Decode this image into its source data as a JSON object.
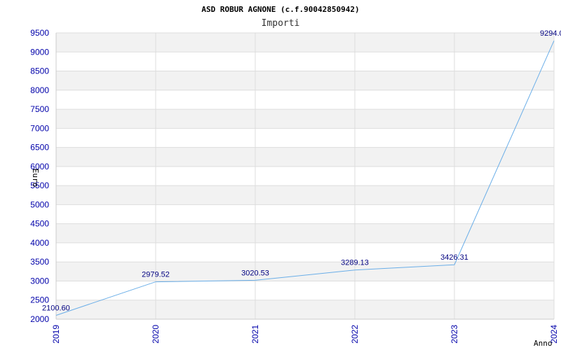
{
  "chart_data": {
    "type": "line",
    "title": "ASD ROBUR AGNONE (c.f.90042850942)",
    "subtitle": "Importi",
    "xlabel": "Anno",
    "ylabel": "Euro",
    "ylim": [
      2000,
      9500
    ],
    "yticks": [
      2000,
      2500,
      3000,
      3500,
      4000,
      4500,
      5000,
      5500,
      6000,
      6500,
      7000,
      7500,
      8000,
      8500,
      9000,
      9500
    ],
    "categories": [
      "2019",
      "2020",
      "2021",
      "2022",
      "2023",
      "2024"
    ],
    "values": [
      2100.6,
      2979.52,
      3020.53,
      3289.13,
      3426.31,
      9294.0
    ],
    "data_labels": [
      "2100.60",
      "2979.52",
      "3020.53",
      "3289.13",
      "3426.31",
      "9294.0"
    ],
    "grid": true,
    "colors": {
      "line": "#6aaee8",
      "band": "#f2f2f2",
      "grid": "#dddddd",
      "tick_text": "#0000aa",
      "data_label": "#000080"
    }
  }
}
